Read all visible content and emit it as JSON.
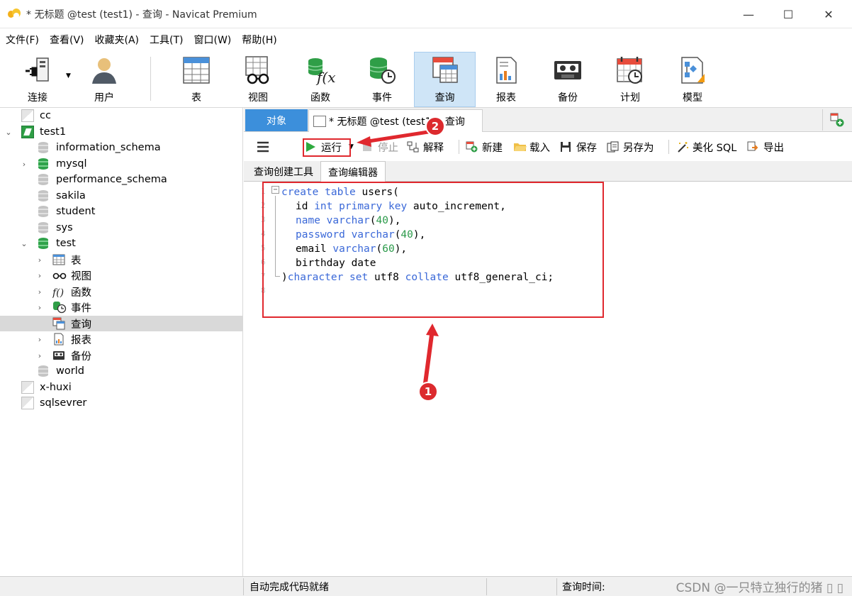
{
  "window": {
    "title": "* 无标题 @test (test1) - 查询 - Navicat Premium",
    "minimize_glyph": "—",
    "maximize_glyph": "☐",
    "close_glyph": "✕"
  },
  "menu": [
    "文件(F)",
    "查看(V)",
    "收藏夹(A)",
    "工具(T)",
    "窗口(W)",
    "帮助(H)"
  ],
  "toolbar": {
    "connect": "连接",
    "user": "用户",
    "table": "表",
    "view": "视图",
    "function": "函数",
    "event": "事件",
    "query": "查询",
    "report": "报表",
    "backup": "备份",
    "schedule": "计划",
    "model": "模型"
  },
  "tree": {
    "cc": "cc",
    "test1": "test1",
    "information_schema": "information_schema",
    "mysql": "mysql",
    "performance_schema": "performance_schema",
    "sakila": "sakila",
    "student": "student",
    "sys": "sys",
    "test": "test",
    "tables": "表",
    "views": "视图",
    "functions": "函数",
    "events": "事件",
    "queries": "查询",
    "reports": "报表",
    "backups": "备份",
    "world": "world",
    "x_huxi": "x-huxi",
    "sqlsevrer": "sqlsevrer"
  },
  "tabs": {
    "objects": "对象",
    "query_tab": "* 无标题 @test (test1) - 查询"
  },
  "query_toolbar": {
    "run": "运行",
    "stop": "停止",
    "explain": "解释",
    "new": "新建",
    "load": "载入",
    "save": "保存",
    "save_as": "另存为",
    "beautify": "美化 SQL",
    "export": "导出"
  },
  "editor_tabs": {
    "builder": "查询创建工具",
    "editor": "查询编辑器"
  },
  "code": {
    "line_numbers": [
      "1",
      "2",
      "3",
      "4",
      "5",
      "6",
      "7",
      "8"
    ],
    "l1": {
      "kw1": "create",
      "kw2": "table",
      "rest": " users("
    },
    "l2": {
      "a": "id ",
      "kw1": "int",
      "kw2": "primary",
      "kw3": "key",
      "rest": " auto_increment,"
    },
    "l3": {
      "kw1": "name",
      "kw2": "varchar",
      "num": "40",
      "rest": "),"
    },
    "l4": {
      "kw1": "password",
      "kw2": "varchar",
      "num": "40",
      "rest": "),"
    },
    "l5": {
      "a": "email ",
      "kw1": "varchar",
      "num": "60",
      "rest": "),"
    },
    "l6": {
      "a": "birthday date"
    },
    "l7": {
      "kw1": "character",
      "kw2": "set",
      "mid": " utf8 ",
      "kw3": "collate",
      "rest": " utf8_general_ci;"
    }
  },
  "status": {
    "left": "自动完成代码就绪",
    "query_time": "查询时间:"
  },
  "annotations": {
    "badge1": "1",
    "badge2": "2",
    "color": "#e0282e"
  },
  "watermark": "CSDN @一只特立独行的猪 ▯ ▯"
}
